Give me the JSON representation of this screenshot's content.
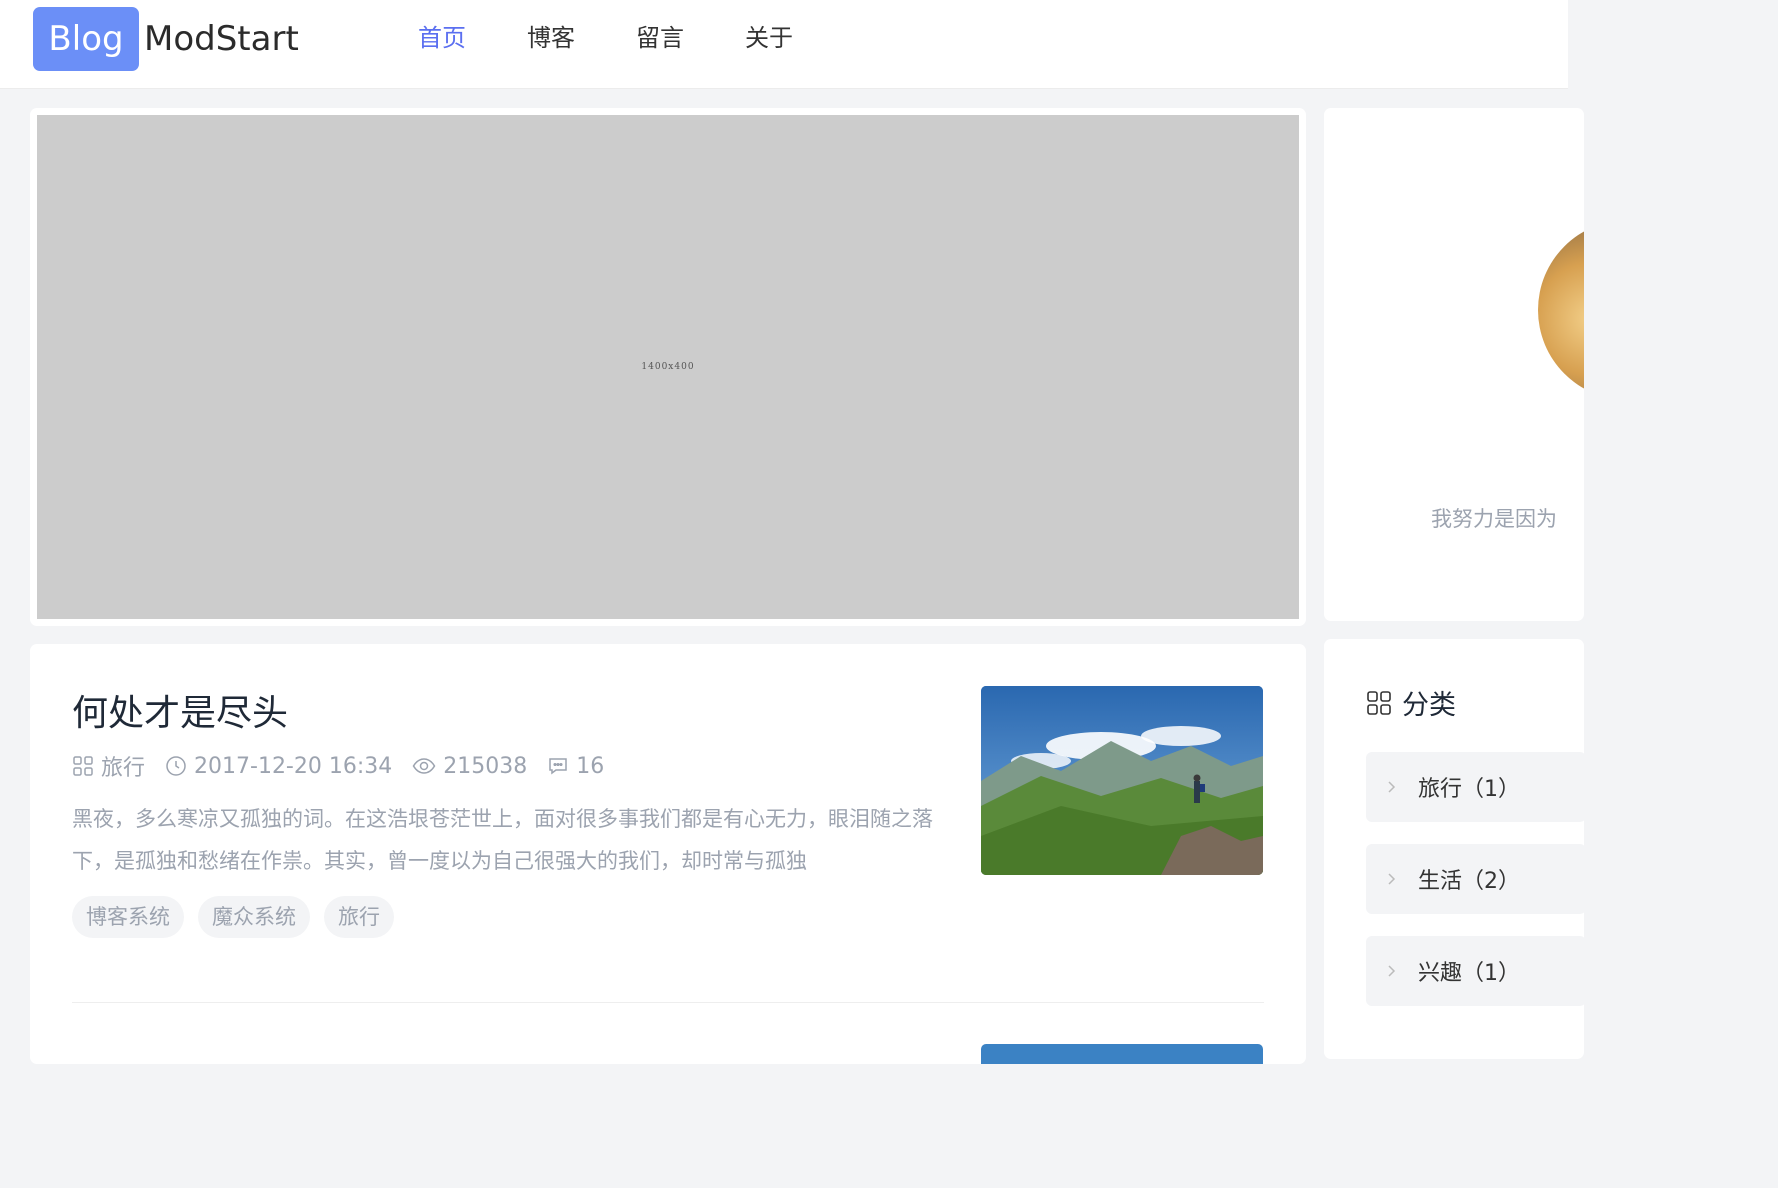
{
  "header": {
    "logo_badge": "Blog",
    "logo_text": "ModStart",
    "nav": [
      {
        "label": "首页",
        "active": true
      },
      {
        "label": "博客"
      },
      {
        "label": "留言"
      },
      {
        "label": "关于"
      }
    ]
  },
  "banner": {
    "placeholder_label": "1400x400"
  },
  "profile": {
    "motto": "我努力是因为"
  },
  "post": {
    "title": "何处才是尽头",
    "category": "旅行",
    "datetime": "2017-12-20 16:34",
    "views": "215038",
    "comments": "16",
    "excerpt": "黑夜，多么寒凉又孤独的词。在这浩垠苍茫世上，面对很多事我们都是有心无力，眼泪随之落下，是孤独和愁绪在作祟。其实，曾一度以为自己很强大的我们，却时常与孤独",
    "tags": [
      "博客系统",
      "魔众系统",
      "旅行"
    ]
  },
  "categories": {
    "title": "分类",
    "items": [
      {
        "label": "旅行（1）"
      },
      {
        "label": "生活（2）"
      },
      {
        "label": "兴趣（1）"
      }
    ]
  },
  "colors": {
    "accent": "#5b6ff0",
    "logo_badge": "#6b8ff7",
    "muted_text": "#9ca3af"
  },
  "icons": {
    "category": "grid-icon",
    "time": "clock-icon",
    "views": "eye-icon",
    "comments": "comment-icon",
    "chevron": "chevron-right-icon"
  }
}
